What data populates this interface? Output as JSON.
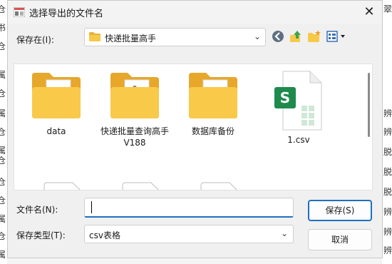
{
  "background_chars": {
    "left": [
      "仓",
      "书",
      "仓",
      "属",
      "仓",
      "属",
      "仓",
      "属",
      "仓",
      "仓",
      "仓",
      "属",
      "仓",
      "属"
    ],
    "right": [
      "翠",
      "辨",
      "辨",
      "脱",
      "脱",
      "脱",
      "辨",
      "辨",
      "辨"
    ]
  },
  "dialog": {
    "title": "选择导出的文件名",
    "close_glyph": "✕"
  },
  "location": {
    "label": "保存在(I):",
    "value": "快递批量高手"
  },
  "toolbar": {
    "icons": [
      "back-icon",
      "up-folder-icon",
      "new-folder-icon",
      "view-menu-icon"
    ]
  },
  "files": [
    {
      "name": "data",
      "type": "folder"
    },
    {
      "name": "快递批量查询高手\nV188",
      "type": "folder-app"
    },
    {
      "name": "数据库备份",
      "type": "folder"
    },
    {
      "name": "1.csv",
      "type": "csv"
    }
  ],
  "form": {
    "filename_label": "文件名(N):",
    "filename_value": "",
    "filetype_label": "保存类型(T):",
    "filetype_value": "csv表格"
  },
  "buttons": {
    "save": "保存(S)",
    "cancel": "取消"
  },
  "colors": {
    "accent": "#1f6fbf",
    "folder": "#f7c948",
    "csv_green": "#1e8a4c"
  }
}
